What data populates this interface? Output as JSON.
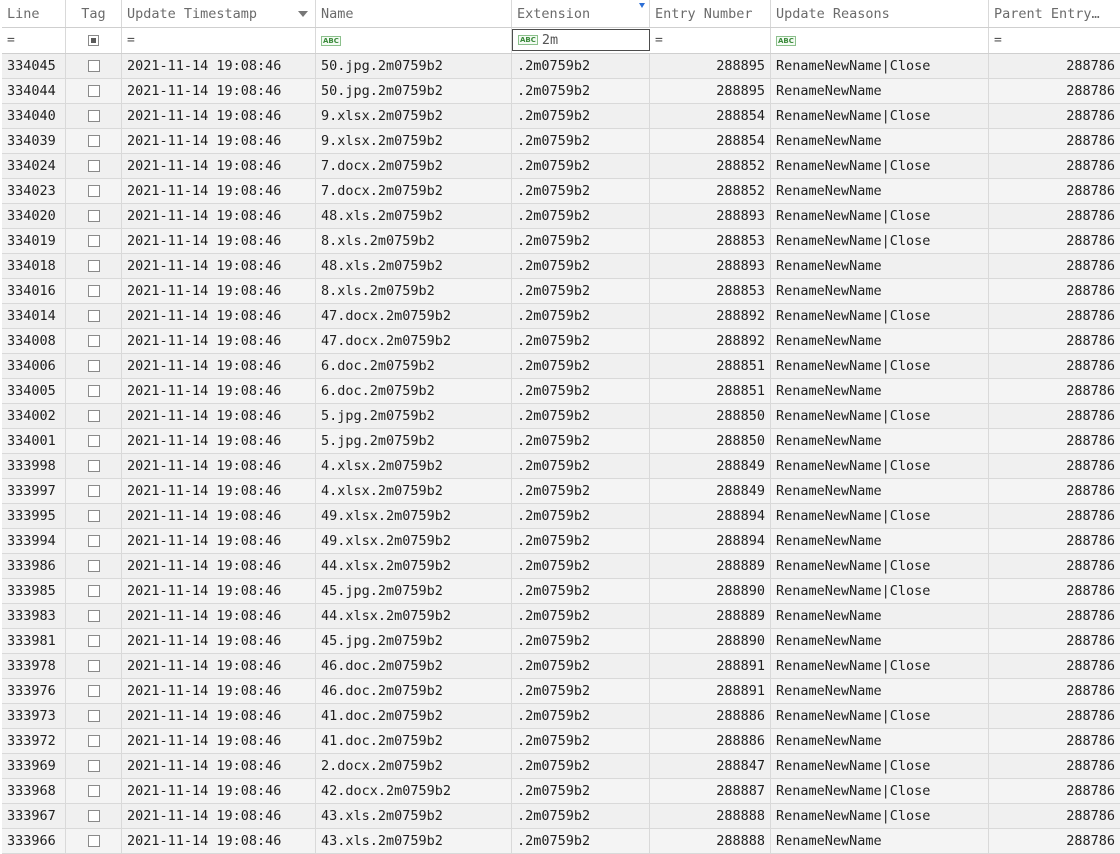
{
  "columns": {
    "line": "Line",
    "tag": "Tag",
    "timestamp": "Update Timestamp",
    "name": "Name",
    "extension": "Extension",
    "entry": "Entry Number",
    "reasons": "Update Reasons",
    "parent": "Parent Entry…"
  },
  "filters": {
    "line": "=",
    "timestamp": "=",
    "name": "",
    "extension": "2m",
    "entry": "=",
    "reasons": "",
    "parent": "="
  },
  "icons": {
    "abc_filter": "abc-filter-icon",
    "sort": "sort-descending-icon",
    "filter_active": "filter-active-icon"
  },
  "rows": [
    {
      "line": "334045",
      "ts": "2021-11-14 19:08:46",
      "name": "50.jpg.2m0759b2",
      "ext": ".2m0759b2",
      "entry": "288895",
      "reasons": "RenameNewName|Close",
      "parent": "288786"
    },
    {
      "line": "334044",
      "ts": "2021-11-14 19:08:46",
      "name": "50.jpg.2m0759b2",
      "ext": ".2m0759b2",
      "entry": "288895",
      "reasons": "RenameNewName",
      "parent": "288786"
    },
    {
      "line": "334040",
      "ts": "2021-11-14 19:08:46",
      "name": "9.xlsx.2m0759b2",
      "ext": ".2m0759b2",
      "entry": "288854",
      "reasons": "RenameNewName|Close",
      "parent": "288786"
    },
    {
      "line": "334039",
      "ts": "2021-11-14 19:08:46",
      "name": "9.xlsx.2m0759b2",
      "ext": ".2m0759b2",
      "entry": "288854",
      "reasons": "RenameNewName",
      "parent": "288786"
    },
    {
      "line": "334024",
      "ts": "2021-11-14 19:08:46",
      "name": "7.docx.2m0759b2",
      "ext": ".2m0759b2",
      "entry": "288852",
      "reasons": "RenameNewName|Close",
      "parent": "288786"
    },
    {
      "line": "334023",
      "ts": "2021-11-14 19:08:46",
      "name": "7.docx.2m0759b2",
      "ext": ".2m0759b2",
      "entry": "288852",
      "reasons": "RenameNewName",
      "parent": "288786"
    },
    {
      "line": "334020",
      "ts": "2021-11-14 19:08:46",
      "name": "48.xls.2m0759b2",
      "ext": ".2m0759b2",
      "entry": "288893",
      "reasons": "RenameNewName|Close",
      "parent": "288786"
    },
    {
      "line": "334019",
      "ts": "2021-11-14 19:08:46",
      "name": "8.xls.2m0759b2",
      "ext": ".2m0759b2",
      "entry": "288853",
      "reasons": "RenameNewName|Close",
      "parent": "288786"
    },
    {
      "line": "334018",
      "ts": "2021-11-14 19:08:46",
      "name": "48.xls.2m0759b2",
      "ext": ".2m0759b2",
      "entry": "288893",
      "reasons": "RenameNewName",
      "parent": "288786"
    },
    {
      "line": "334016",
      "ts": "2021-11-14 19:08:46",
      "name": "8.xls.2m0759b2",
      "ext": ".2m0759b2",
      "entry": "288853",
      "reasons": "RenameNewName",
      "parent": "288786"
    },
    {
      "line": "334014",
      "ts": "2021-11-14 19:08:46",
      "name": "47.docx.2m0759b2",
      "ext": ".2m0759b2",
      "entry": "288892",
      "reasons": "RenameNewName|Close",
      "parent": "288786"
    },
    {
      "line": "334008",
      "ts": "2021-11-14 19:08:46",
      "name": "47.docx.2m0759b2",
      "ext": ".2m0759b2",
      "entry": "288892",
      "reasons": "RenameNewName",
      "parent": "288786"
    },
    {
      "line": "334006",
      "ts": "2021-11-14 19:08:46",
      "name": "6.doc.2m0759b2",
      "ext": ".2m0759b2",
      "entry": "288851",
      "reasons": "RenameNewName|Close",
      "parent": "288786"
    },
    {
      "line": "334005",
      "ts": "2021-11-14 19:08:46",
      "name": "6.doc.2m0759b2",
      "ext": ".2m0759b2",
      "entry": "288851",
      "reasons": "RenameNewName",
      "parent": "288786"
    },
    {
      "line": "334002",
      "ts": "2021-11-14 19:08:46",
      "name": "5.jpg.2m0759b2",
      "ext": ".2m0759b2",
      "entry": "288850",
      "reasons": "RenameNewName|Close",
      "parent": "288786"
    },
    {
      "line": "334001",
      "ts": "2021-11-14 19:08:46",
      "name": "5.jpg.2m0759b2",
      "ext": ".2m0759b2",
      "entry": "288850",
      "reasons": "RenameNewName",
      "parent": "288786"
    },
    {
      "line": "333998",
      "ts": "2021-11-14 19:08:46",
      "name": "4.xlsx.2m0759b2",
      "ext": ".2m0759b2",
      "entry": "288849",
      "reasons": "RenameNewName|Close",
      "parent": "288786"
    },
    {
      "line": "333997",
      "ts": "2021-11-14 19:08:46",
      "name": "4.xlsx.2m0759b2",
      "ext": ".2m0759b2",
      "entry": "288849",
      "reasons": "RenameNewName",
      "parent": "288786"
    },
    {
      "line": "333995",
      "ts": "2021-11-14 19:08:46",
      "name": "49.xlsx.2m0759b2",
      "ext": ".2m0759b2",
      "entry": "288894",
      "reasons": "RenameNewName|Close",
      "parent": "288786"
    },
    {
      "line": "333994",
      "ts": "2021-11-14 19:08:46",
      "name": "49.xlsx.2m0759b2",
      "ext": ".2m0759b2",
      "entry": "288894",
      "reasons": "RenameNewName",
      "parent": "288786"
    },
    {
      "line": "333986",
      "ts": "2021-11-14 19:08:46",
      "name": "44.xlsx.2m0759b2",
      "ext": ".2m0759b2",
      "entry": "288889",
      "reasons": "RenameNewName|Close",
      "parent": "288786"
    },
    {
      "line": "333985",
      "ts": "2021-11-14 19:08:46",
      "name": "45.jpg.2m0759b2",
      "ext": ".2m0759b2",
      "entry": "288890",
      "reasons": "RenameNewName|Close",
      "parent": "288786"
    },
    {
      "line": "333983",
      "ts": "2021-11-14 19:08:46",
      "name": "44.xlsx.2m0759b2",
      "ext": ".2m0759b2",
      "entry": "288889",
      "reasons": "RenameNewName",
      "parent": "288786"
    },
    {
      "line": "333981",
      "ts": "2021-11-14 19:08:46",
      "name": "45.jpg.2m0759b2",
      "ext": ".2m0759b2",
      "entry": "288890",
      "reasons": "RenameNewName",
      "parent": "288786"
    },
    {
      "line": "333978",
      "ts": "2021-11-14 19:08:46",
      "name": "46.doc.2m0759b2",
      "ext": ".2m0759b2",
      "entry": "288891",
      "reasons": "RenameNewName|Close",
      "parent": "288786"
    },
    {
      "line": "333976",
      "ts": "2021-11-14 19:08:46",
      "name": "46.doc.2m0759b2",
      "ext": ".2m0759b2",
      "entry": "288891",
      "reasons": "RenameNewName",
      "parent": "288786"
    },
    {
      "line": "333973",
      "ts": "2021-11-14 19:08:46",
      "name": "41.doc.2m0759b2",
      "ext": ".2m0759b2",
      "entry": "288886",
      "reasons": "RenameNewName|Close",
      "parent": "288786"
    },
    {
      "line": "333972",
      "ts": "2021-11-14 19:08:46",
      "name": "41.doc.2m0759b2",
      "ext": ".2m0759b2",
      "entry": "288886",
      "reasons": "RenameNewName",
      "parent": "288786"
    },
    {
      "line": "333969",
      "ts": "2021-11-14 19:08:46",
      "name": "2.docx.2m0759b2",
      "ext": ".2m0759b2",
      "entry": "288847",
      "reasons": "RenameNewName|Close",
      "parent": "288786"
    },
    {
      "line": "333968",
      "ts": "2021-11-14 19:08:46",
      "name": "42.docx.2m0759b2",
      "ext": ".2m0759b2",
      "entry": "288887",
      "reasons": "RenameNewName|Close",
      "parent": "288786"
    },
    {
      "line": "333967",
      "ts": "2021-11-14 19:08:46",
      "name": "43.xls.2m0759b2",
      "ext": ".2m0759b2",
      "entry": "288888",
      "reasons": "RenameNewName|Close",
      "parent": "288786"
    },
    {
      "line": "333966",
      "ts": "2021-11-14 19:08:46",
      "name": "43.xls.2m0759b2",
      "ext": ".2m0759b2",
      "entry": "288888",
      "reasons": "RenameNewName",
      "parent": "288786"
    }
  ]
}
